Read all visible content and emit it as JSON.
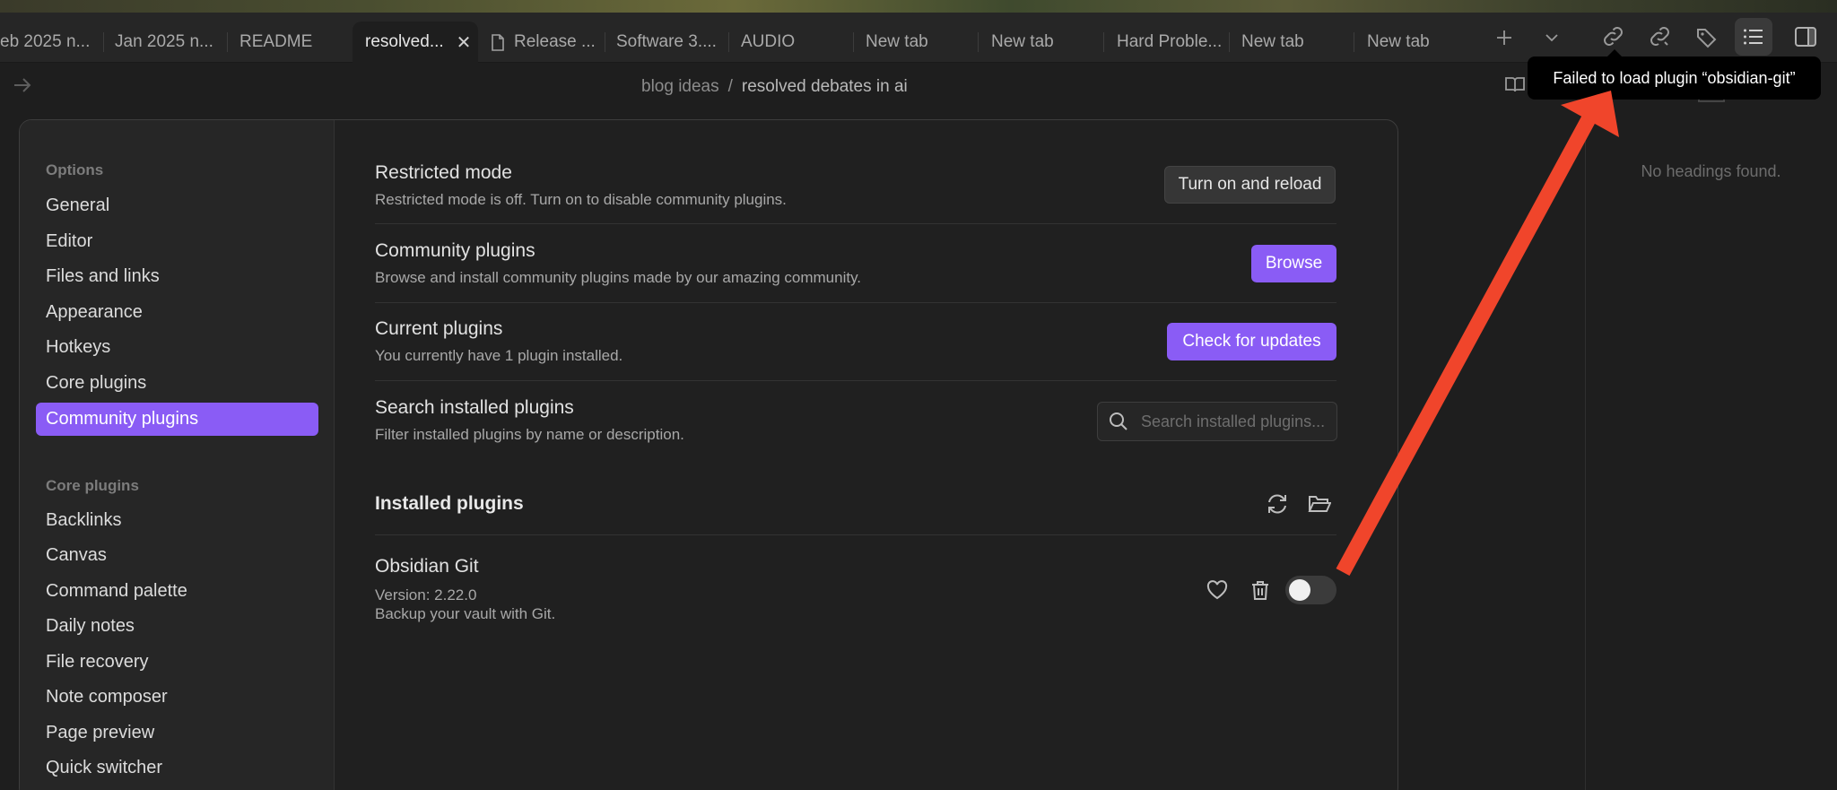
{
  "tabs": [
    {
      "label": "eb 2025 n...",
      "active": false
    },
    {
      "label": "Jan 2025 n...",
      "active": false
    },
    {
      "label": "README",
      "active": false
    },
    {
      "label": "resolved...",
      "active": true
    },
    {
      "label": "Release ...",
      "active": false,
      "icon": "document-icon"
    },
    {
      "label": "Software 3....",
      "active": false
    },
    {
      "label": "AUDIO",
      "active": false
    },
    {
      "label": "New tab",
      "active": false
    },
    {
      "label": "New tab",
      "active": false
    },
    {
      "label": "Hard Proble...",
      "active": false
    },
    {
      "label": "New tab",
      "active": false
    },
    {
      "label": "New tab",
      "active": false
    }
  ],
  "toolbar_icons": [
    "new-tab-icon",
    "tab-list-icon",
    "backlinks-icon",
    "outgoing-links-icon",
    "tags-icon",
    "outline-icon",
    "sidebar-toggle-icon"
  ],
  "breadcrumb": {
    "folder": "blog ideas",
    "separator": "/",
    "current": "resolved debates in ai"
  },
  "tooltip": {
    "text": "Failed to load plugin “obsidian-git”"
  },
  "outline": {
    "empty_text": "No headings found."
  },
  "settings_sidebar": {
    "options_heading": "Options",
    "options": [
      "General",
      "Editor",
      "Files and links",
      "Appearance",
      "Hotkeys",
      "Core plugins",
      "Community plugins"
    ],
    "active": "Community plugins",
    "core_heading": "Core plugins",
    "core": [
      "Backlinks",
      "Canvas",
      "Command palette",
      "Daily notes",
      "File recovery",
      "Note composer",
      "Page preview",
      "Quick switcher"
    ]
  },
  "settings": {
    "restricted": {
      "name": "Restricted mode",
      "desc": "Restricted mode is off. Turn on to disable community plugins.",
      "button": "Turn on and reload"
    },
    "community": {
      "name": "Community plugins",
      "desc": "Browse and install community plugins made by our amazing community.",
      "button": "Browse"
    },
    "current": {
      "name": "Current plugins",
      "desc": "You currently have 1 plugin installed.",
      "button": "Check for updates"
    },
    "search": {
      "name": "Search installed plugins",
      "desc": "Filter installed plugins by name or description.",
      "placeholder": "Search installed plugins...",
      "value": ""
    }
  },
  "installed": {
    "title": "Installed plugins",
    "plugins": [
      {
        "name": "Obsidian Git",
        "version": "Version: 2.22.0",
        "description": "Backup your vault with Git.",
        "enabled": false
      }
    ]
  },
  "colors": {
    "accent": "#8a5cf5",
    "annotation_arrow": "#f0452b",
    "background": "#1e1e1e"
  }
}
